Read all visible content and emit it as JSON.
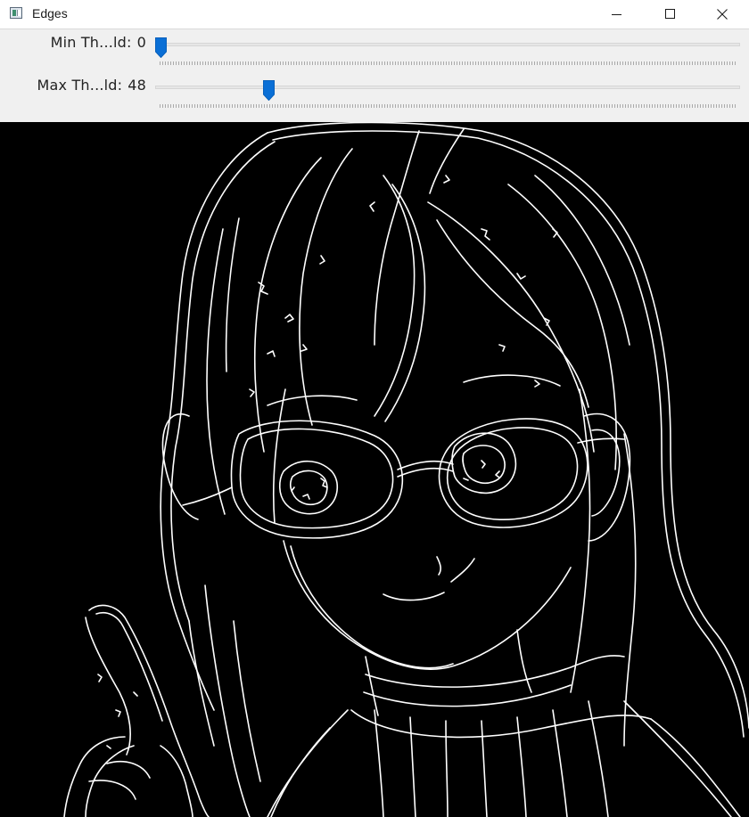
{
  "window": {
    "title": "Edges",
    "icon": "app-window-icon",
    "controls": [
      "minimize-icon",
      "maximize-icon",
      "close-icon"
    ]
  },
  "trackbars": [
    {
      "label": "Min Th...ld:",
      "value": "0",
      "min": 0,
      "max": 255,
      "position": 0
    },
    {
      "label": "Max Th...ld:",
      "value": "48",
      "min": 0,
      "max": 255,
      "position": 48
    }
  ],
  "image": {
    "description_name": "canny-edges-output",
    "background": "#000000",
    "stroke": "#ffffff"
  },
  "colors": {
    "thumb": "#0a6fd6",
    "panel": "#f0f0f0",
    "titlebar": "#ffffff"
  }
}
